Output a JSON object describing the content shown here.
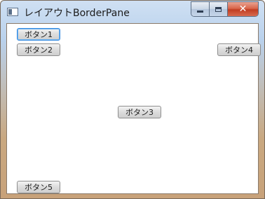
{
  "window": {
    "title": "レイアウトBorderPane"
  },
  "buttons": {
    "b1": "ボタン1",
    "b2": "ボタン2",
    "b3": "ボタン3",
    "b4": "ボタン4",
    "b5": "ボタン5"
  },
  "colors": {
    "focus": "#3b8de0",
    "close": "#c13d22"
  }
}
